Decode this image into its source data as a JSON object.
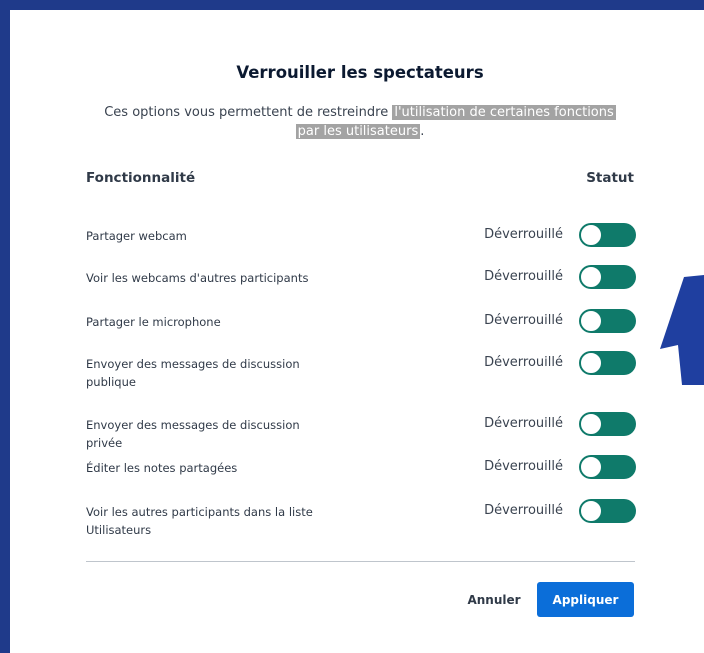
{
  "dialog": {
    "title": "Verrouiller les spectateurs",
    "description_plain": "Ces options vous permettent de restreindre ",
    "description_highlight_1": "l'utilisation de certaines fonctions",
    "description_highlight_2": "par les utilisateurs",
    "description_end": ".",
    "highlight_color": "#a3a3a3"
  },
  "columns": {
    "feature": "Fonctionnalité",
    "status": "Statut"
  },
  "rows": [
    {
      "label": "Partager webcam",
      "status": "Déverrouillé",
      "toggle_on": true
    },
    {
      "label": "Voir les webcams d'autres participants",
      "status": "Déverrouillé",
      "toggle_on": true
    },
    {
      "label": "Partager le microphone",
      "status": "Déverrouillé",
      "toggle_on": true
    },
    {
      "label": "Envoyer des messages de discussion publique",
      "status": "Déverrouillé",
      "toggle_on": true
    },
    {
      "label": "Envoyer des messages de discussion privée",
      "status": "Déverrouillé",
      "toggle_on": true
    },
    {
      "label": "Éditer les notes partagées",
      "status": "Déverrouillé",
      "toggle_on": true
    },
    {
      "label": "Voir les autres participants dans la liste Utilisateurs",
      "status": "Déverrouillé",
      "toggle_on": true
    }
  ],
  "buttons": {
    "cancel": "Annuler",
    "apply": "Appliquer"
  },
  "colors": {
    "frame": "#1f3a8a",
    "toggle": "#0f7a6a",
    "primary_button": "#0b6ed9",
    "arrow": "#1f3fa0"
  },
  "annotation": {
    "icon": "arrow-pointer-icon"
  }
}
